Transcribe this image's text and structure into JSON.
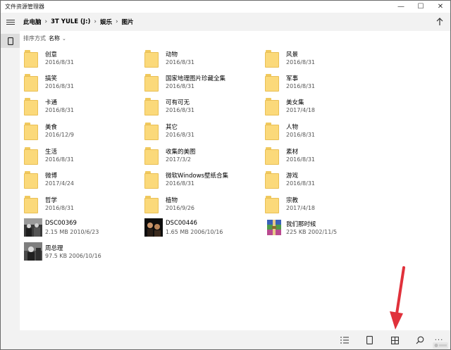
{
  "window": {
    "title": "文件资源管理器",
    "controls": {
      "minimize": "—",
      "maximize": "☐",
      "close": "✕"
    }
  },
  "breadcrumb": {
    "items": [
      "此电脑",
      "3T YULE (J:)",
      "娱乐",
      "图片"
    ],
    "separator": "›"
  },
  "sort": {
    "label": "排序方式",
    "value": "名称",
    "chevron": "⌄"
  },
  "items": [
    {
      "type": "folder",
      "name": "创意",
      "meta": "2016/8/31"
    },
    {
      "type": "folder",
      "name": "动物",
      "meta": "2016/8/31"
    },
    {
      "type": "folder",
      "name": "风景",
      "meta": "2016/8/31"
    },
    {
      "type": "folder",
      "name": "搞笑",
      "meta": "2016/8/31"
    },
    {
      "type": "folder",
      "name": "国家地理图片珍藏全集",
      "meta": "2016/8/31"
    },
    {
      "type": "folder",
      "name": "军事",
      "meta": "2016/8/31"
    },
    {
      "type": "folder",
      "name": "卡通",
      "meta": "2016/8/31"
    },
    {
      "type": "folder",
      "name": "可有可无",
      "meta": "2016/8/31"
    },
    {
      "type": "folder",
      "name": "美女集",
      "meta": "2017/4/18"
    },
    {
      "type": "folder",
      "name": "美食",
      "meta": "2016/12/9"
    },
    {
      "type": "folder",
      "name": "其它",
      "meta": "2016/8/31"
    },
    {
      "type": "folder",
      "name": "人物",
      "meta": "2016/8/31"
    },
    {
      "type": "folder",
      "name": "生活",
      "meta": "2016/8/31"
    },
    {
      "type": "folder",
      "name": "收集的美图",
      "meta": "2017/3/2"
    },
    {
      "type": "folder",
      "name": "素材",
      "meta": "2016/8/31"
    },
    {
      "type": "folder",
      "name": "微博",
      "meta": "2017/4/24"
    },
    {
      "type": "folder",
      "name": "微软Windows壁纸合集",
      "meta": "2016/8/31"
    },
    {
      "type": "folder",
      "name": "游戏",
      "meta": "2016/8/31"
    },
    {
      "type": "folder",
      "name": "哲学",
      "meta": "2016/8/31"
    },
    {
      "type": "folder",
      "name": "植物",
      "meta": "2016/9/26"
    },
    {
      "type": "folder",
      "name": "宗教",
      "meta": "2017/4/18"
    },
    {
      "type": "image",
      "thumb": "photo-thumb-bw-people",
      "name": "DSC00369",
      "meta": "2.15 MB 2010/6/23"
    },
    {
      "type": "image",
      "thumb": "photo-thumb-dark-figures",
      "name": "DSC00446",
      "meta": "1.65 MB 2006/10/16"
    },
    {
      "type": "archive",
      "thumb": "winrar-archive-icon",
      "name": "我们那时候",
      "meta": "225 KB 2002/11/5"
    },
    {
      "type": "image",
      "thumb": "photo-thumb-bw-portrait",
      "name": "周总理",
      "meta": "97.5 KB 2006/10/16"
    }
  ],
  "bottombar": {
    "buttons": [
      "list-view-icon",
      "tablet-icon",
      "grid-view-icon",
      "search-icon"
    ],
    "more": "···"
  },
  "colors": {
    "folder": "#fbd97a",
    "folder_edge": "#e9bf55",
    "toolbar": "#f2f2f2",
    "annotation_arrow": "#e0313b"
  }
}
